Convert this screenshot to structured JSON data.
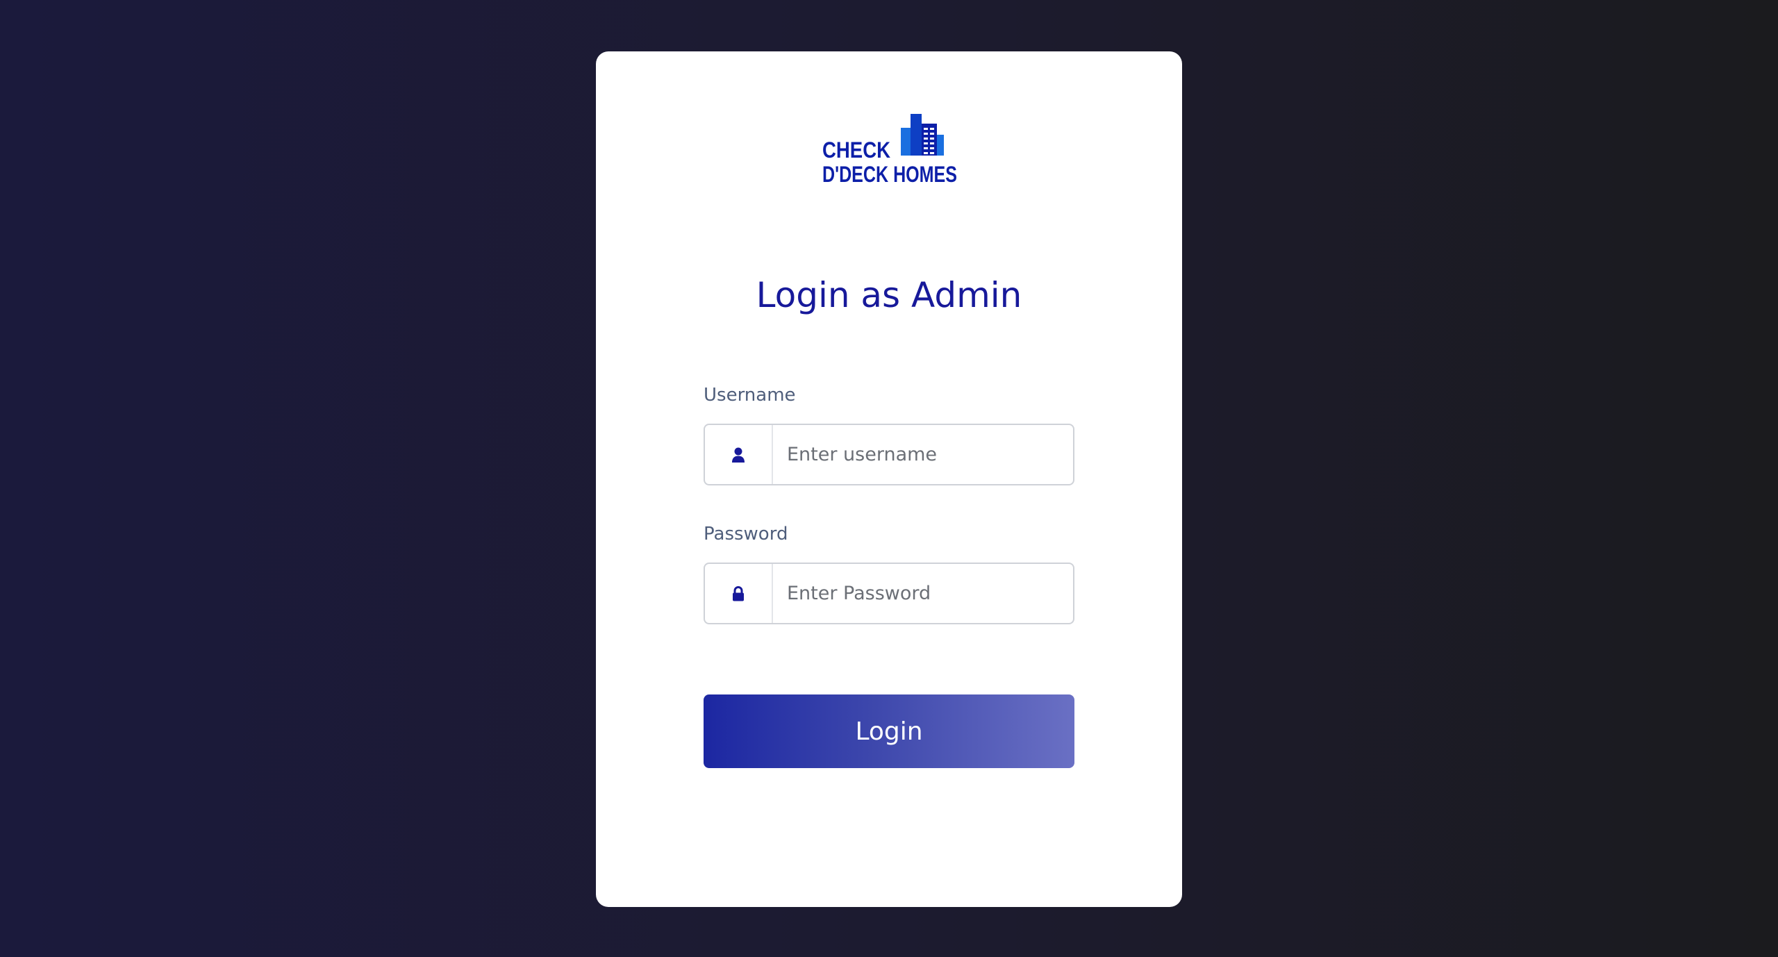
{
  "brand": {
    "line1": "CHECK",
    "line2": "D'DECK HOMES",
    "logo_icon": "buildings-icon",
    "color": "#0d1fa8"
  },
  "login": {
    "title": "Login as Admin",
    "username": {
      "label": "Username",
      "placeholder": "Enter username",
      "icon": "user-icon"
    },
    "password": {
      "label": "Password",
      "placeholder": "Enter Password",
      "icon": "lock-icon"
    },
    "button_label": "Login"
  },
  "colors": {
    "accent": "#17199a",
    "button_start": "#1c27a2",
    "button_end": "#6a70c4"
  }
}
